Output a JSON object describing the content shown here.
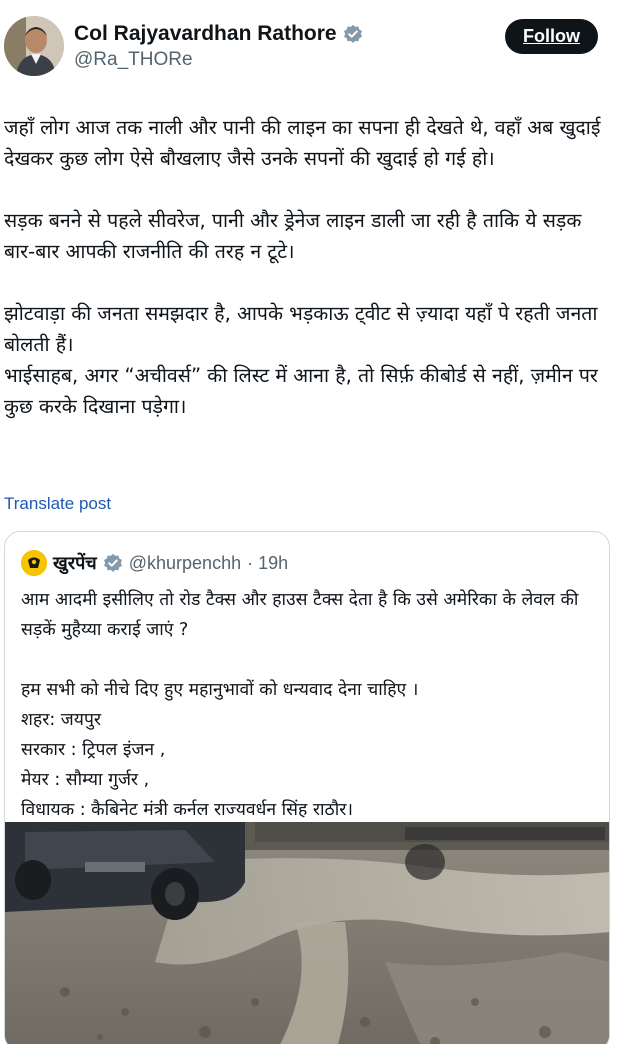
{
  "author": {
    "display_name": "Col Rajyavardhan Rathore",
    "handle": "@Ra_THORe"
  },
  "follow_label": "Follow",
  "tweet": {
    "para1": "जहाँ लोग आज तक नाली और पानी की लाइन का सपना ही देखते थे, वहाँ अब खुदाई देखकर कुछ लोग ऐसे बौखलाए जैसे उनके सपनों की खुदाई हो गई हो।",
    "para2": "सड़क बनने से पहले सीवरेज, पानी और ड्रेनेज लाइन डाली जा रही है ताकि ये सड़क बार-बार आपकी राजनीति की तरह न टूटे।",
    "para3": "झोटवाड़ा की जनता समझदार है, आपके भड़काऊ ट्वीट से ज़्यादा यहाँ पे रहती जनता बोलती हैं।",
    "para4": "भाईसाहब, अगर “अचीवर्स” की लिस्ट में आना है, तो सिर्फ़ कीबोर्ड से नहीं, ज़मीन पर कुछ करके दिखाना पड़ेगा।"
  },
  "translate_label": "Translate post",
  "quote": {
    "name": "खुरपेंच",
    "handle": "@khurpenchh",
    "time": "· 19h",
    "para1": "आम आदमी इसीलिए तो रोड टैक्स और हाउस टैक्स देता है कि उसे अमेरिका के लेवल की सड़कें मुहैय्या कराई जाएं ?",
    "line1": "हम सभी को नीचे दिए हुए महानुभावों को धन्यवाद देना चाहिए ।",
    "line2": "शहर: जयपुर",
    "line3": "सरकार : ट्रिपल इंजन ,",
    "line4": "मेयर : सौम्या गुर्जर ,",
    "line5": "विधायक : कैबिनेट मंत्री कर्नल राज्यवर्धन सिंह राठौर।"
  },
  "colors": {
    "verified_badge": "#829aab",
    "link": "#1d59b4",
    "follow_bg": "#0f1419"
  }
}
